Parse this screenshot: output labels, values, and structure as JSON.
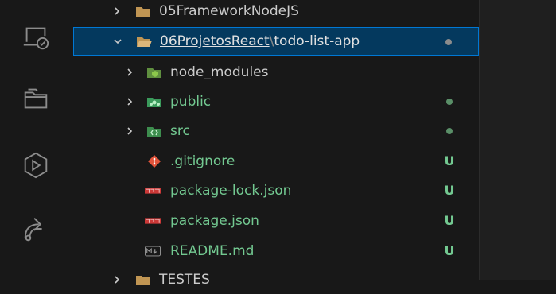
{
  "colors": {
    "git_untracked": "#73c991",
    "selection_bg": "#04395e",
    "selection_border": "#0078d4",
    "icon_gray": "#8c8c8c"
  },
  "activity_bar": {
    "icons": [
      "remote-explorer-icon",
      "files-icon",
      "extensions-icon",
      "source-control-icon"
    ]
  },
  "tree": {
    "rows": [
      {
        "label": "05FrameworkNodeJS",
        "type": "folder"
      },
      {
        "label_a": "06ProjetosReact",
        "separator": "\\",
        "label_b": "todo-list-app",
        "type": "folder-open"
      },
      {
        "label": "node_modules",
        "type": "folder"
      },
      {
        "label": "public",
        "type": "folder"
      },
      {
        "label": "src",
        "type": "folder"
      },
      {
        "label": ".gitignore",
        "status": "U"
      },
      {
        "label": "package-lock.json",
        "status": "U"
      },
      {
        "label": "package.json",
        "status": "U"
      },
      {
        "label": "README.md",
        "status": "U"
      },
      {
        "label": "TESTES",
        "type": "folder"
      }
    ]
  }
}
